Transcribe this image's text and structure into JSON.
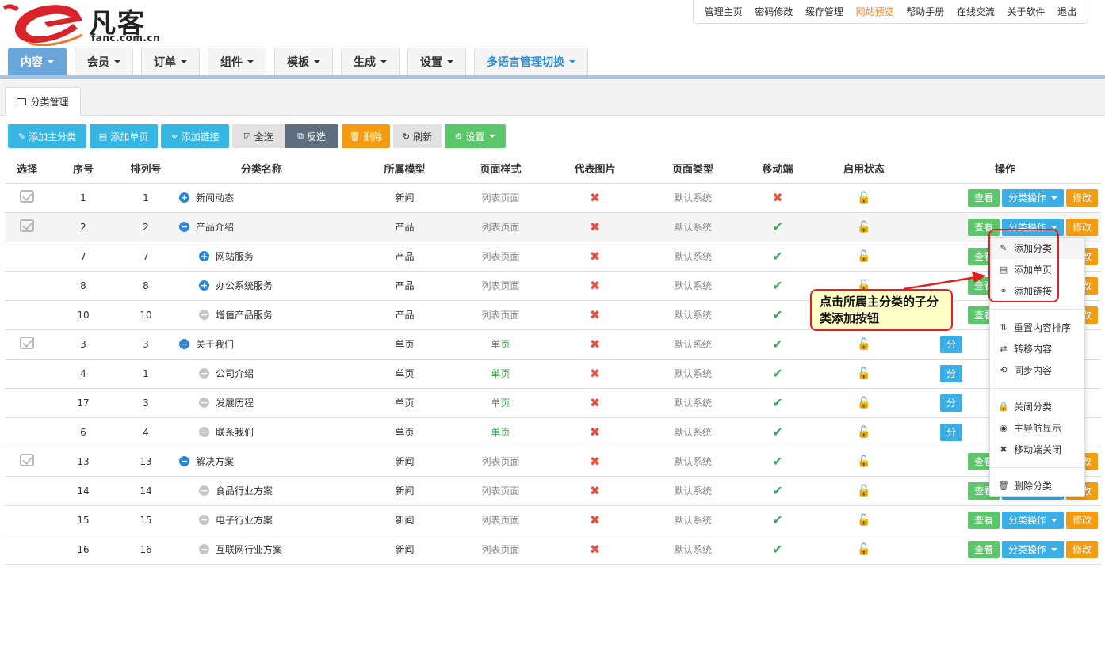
{
  "logo": {
    "text": "凡客",
    "domain": "fanc.com.cn"
  },
  "topnav": [
    {
      "label": "管理主页",
      "active": false
    },
    {
      "label": "密码修改",
      "active": false
    },
    {
      "label": "缓存管理",
      "active": false
    },
    {
      "label": "网站预览",
      "active": true
    },
    {
      "label": "帮助手册",
      "active": false
    },
    {
      "label": "在线交流",
      "active": false
    },
    {
      "label": "关于软件",
      "active": false
    },
    {
      "label": "退出",
      "active": false
    }
  ],
  "mainnav": [
    "内容",
    "会员",
    "订单",
    "组件",
    "模板",
    "生成",
    "设置",
    "多语言管理切换"
  ],
  "subtab": "分类管理",
  "toolbar": {
    "add_main": "添加主分类",
    "add_page": "添加单页",
    "add_link": "添加链接",
    "select_all": "全选",
    "invert": "反选",
    "delete": "删除",
    "refresh": "刷新",
    "settings": "设置"
  },
  "columns": [
    "选择",
    "序号",
    "排列号",
    "分类名称",
    "所属模型",
    "页面样式",
    "代表图片",
    "页面类型",
    "移动端",
    "启用状态",
    "操作"
  ],
  "rows": [
    {
      "check": true,
      "id": "1",
      "order": "1",
      "name": "新闻动态",
      "level": 0,
      "icon": "plus",
      "model": "新闻",
      "style": "列表页面",
      "style_type": "list",
      "type": "默认系统",
      "mobile": false
    },
    {
      "check": true,
      "id": "2",
      "order": "2",
      "name": "产品介绍",
      "level": 0,
      "icon": "minus",
      "model": "产品",
      "style": "列表页面",
      "style_type": "list",
      "type": "默认系统",
      "mobile": true
    },
    {
      "check": false,
      "id": "7",
      "order": "7",
      "name": "网站服务",
      "level": 1,
      "icon": "plus",
      "model": "产品",
      "style": "列表页面",
      "style_type": "list",
      "type": "默认系统",
      "mobile": true
    },
    {
      "check": false,
      "id": "8",
      "order": "8",
      "name": "办公系统服务",
      "level": 1,
      "icon": "plus",
      "model": "产品",
      "style": "列表页面",
      "style_type": "list",
      "type": "默认系统",
      "mobile": true
    },
    {
      "check": false,
      "id": "10",
      "order": "10",
      "name": "增值产品服务",
      "level": 1,
      "icon": "leaf",
      "model": "产品",
      "style": "列表页面",
      "style_type": "list",
      "type": "默认系统",
      "mobile": true
    },
    {
      "check": true,
      "id": "3",
      "order": "3",
      "name": "关于我们",
      "level": 0,
      "icon": "minus",
      "model": "单页",
      "style": "单页",
      "style_type": "single",
      "type": "默认系统",
      "mobile": true
    },
    {
      "check": false,
      "id": "4",
      "order": "1",
      "name": "公司介绍",
      "level": 1,
      "icon": "leaf",
      "model": "单页",
      "style": "单页",
      "style_type": "single",
      "type": "默认系统",
      "mobile": true
    },
    {
      "check": false,
      "id": "17",
      "order": "3",
      "name": "发展历程",
      "level": 1,
      "icon": "leaf",
      "model": "单页",
      "style": "单页",
      "style_type": "single",
      "type": "默认系统",
      "mobile": true
    },
    {
      "check": false,
      "id": "6",
      "order": "4",
      "name": "联系我们",
      "level": 1,
      "icon": "leaf",
      "model": "单页",
      "style": "单页",
      "style_type": "single",
      "type": "默认系统",
      "mobile": true
    },
    {
      "check": true,
      "id": "13",
      "order": "13",
      "name": "解决方案",
      "level": 0,
      "icon": "minus",
      "model": "新闻",
      "style": "列表页面",
      "style_type": "list",
      "type": "默认系统",
      "mobile": true
    },
    {
      "check": false,
      "id": "14",
      "order": "14",
      "name": "食品行业方案",
      "level": 1,
      "icon": "leaf",
      "model": "新闻",
      "style": "列表页面",
      "style_type": "list",
      "type": "默认系统",
      "mobile": true
    },
    {
      "check": false,
      "id": "15",
      "order": "15",
      "name": "电子行业方案",
      "level": 1,
      "icon": "leaf",
      "model": "新闻",
      "style": "列表页面",
      "style_type": "list",
      "type": "默认系统",
      "mobile": true
    },
    {
      "check": false,
      "id": "16",
      "order": "16",
      "name": "互联网行业方案",
      "level": 1,
      "icon": "leaf",
      "model": "新闻",
      "style": "列表页面",
      "style_type": "list",
      "type": "默认系统",
      "mobile": true
    }
  ],
  "ops": {
    "view": "查看",
    "cat_ops": "分类操作",
    "cat_ops_short": "分",
    "edit": "修改"
  },
  "dropdown": [
    "添加分类",
    "添加单页",
    "添加链接",
    "重置内容排序",
    "转移内容",
    "同步内容",
    "关闭分类",
    "主导航显示",
    "移动端关闭",
    "删除分类"
  ],
  "callout": "点击所属主分类的子分类添加按钮",
  "colors": {
    "accent_blue": "#37b6e4",
    "orange": "#f39c12",
    "green": "#5cc66b",
    "red": "#e8543f"
  }
}
